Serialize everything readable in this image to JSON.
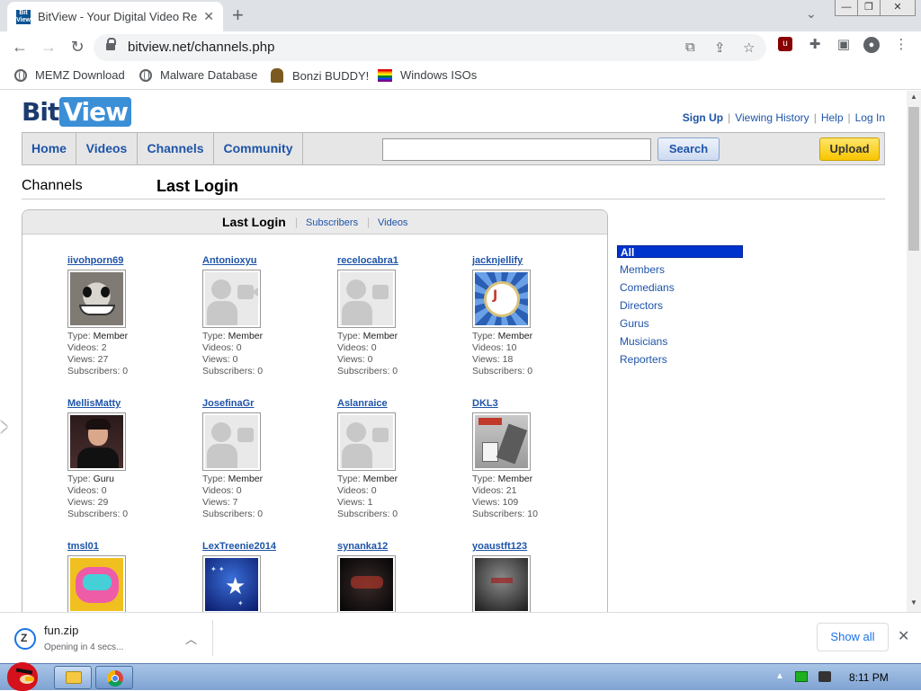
{
  "browser": {
    "tab_title": "BitView - Your Digital Video Re",
    "tab_favicon_top": "Bit",
    "tab_favicon_bottom": "View",
    "url": "bitview.net/channels.php",
    "bookmarks": [
      {
        "label": "MEMZ Download",
        "icon": "globe-icon"
      },
      {
        "label": "Malware Database",
        "icon": "globe-icon"
      },
      {
        "label": "Bonzi BUDDY!",
        "icon": "bonzi-icon"
      },
      {
        "label": "Windows ISOs",
        "icon": "rainbow-flag-icon"
      }
    ]
  },
  "site": {
    "logo_bit": "Bit",
    "logo_view": "View",
    "user_links": {
      "signup": "Sign Up",
      "history": "Viewing History",
      "help": "Help",
      "login": "Log In"
    },
    "nav": [
      "Home",
      "Videos",
      "Channels",
      "Community"
    ],
    "search_placeholder": "",
    "search_label": "Search",
    "upload_label": "Upload",
    "page_heading": "Channels",
    "sub_heading": "Last Login",
    "panel_tabs": {
      "active": "Last Login",
      "subscribers": "Subscribers",
      "videos": "Videos"
    },
    "meta_labels": {
      "type": "Type:",
      "videos": "Videos:",
      "views": "Views:",
      "subscribers": "Subscribers:"
    },
    "channels": [
      {
        "name": "iivohporn69",
        "type": "Member",
        "videos": "2",
        "views": "27",
        "subscribers": "0",
        "avatar": "grin-face"
      },
      {
        "name": "Antonioxyu",
        "type": "Member",
        "videos": "0",
        "views": "0",
        "subscribers": "0",
        "avatar": "default"
      },
      {
        "name": "recelocabra1",
        "type": "Member",
        "videos": "0",
        "views": "0",
        "subscribers": "0",
        "avatar": "default"
      },
      {
        "name": "jacknjellify",
        "type": "Member",
        "videos": "10",
        "views": "18",
        "subscribers": "0",
        "avatar": "jnj-logo"
      },
      {
        "name": "MellisMatty",
        "type": "Guru",
        "videos": "0",
        "views": "29",
        "subscribers": "0",
        "avatar": "person-photo"
      },
      {
        "name": "JosefinaGr",
        "type": "Member",
        "videos": "0",
        "views": "7",
        "subscribers": "0",
        "avatar": "default"
      },
      {
        "name": "Aslanraice",
        "type": "Member",
        "videos": "0",
        "views": "1",
        "subscribers": "0",
        "avatar": "default"
      },
      {
        "name": "DKL3",
        "type": "Member",
        "videos": "21",
        "views": "109",
        "subscribers": "10",
        "avatar": "hardware-photo"
      },
      {
        "name": "tmsl01",
        "avatar": "pink-robot"
      },
      {
        "name": "LexTreenie2014",
        "avatar": "blue-stars"
      },
      {
        "name": "synanka12",
        "avatar": "dark-logo"
      },
      {
        "name": "yoaustft123",
        "avatar": "dark-gradient"
      }
    ],
    "categories": [
      "All",
      "Members",
      "Comedians",
      "Directors",
      "Gurus",
      "Musicians",
      "Reporters"
    ],
    "active_category": "All"
  },
  "download": {
    "filename": "fun.zip",
    "status": "Opening in 4 secs...",
    "show_all": "Show all"
  },
  "taskbar": {
    "clock": "8:11 PM"
  }
}
